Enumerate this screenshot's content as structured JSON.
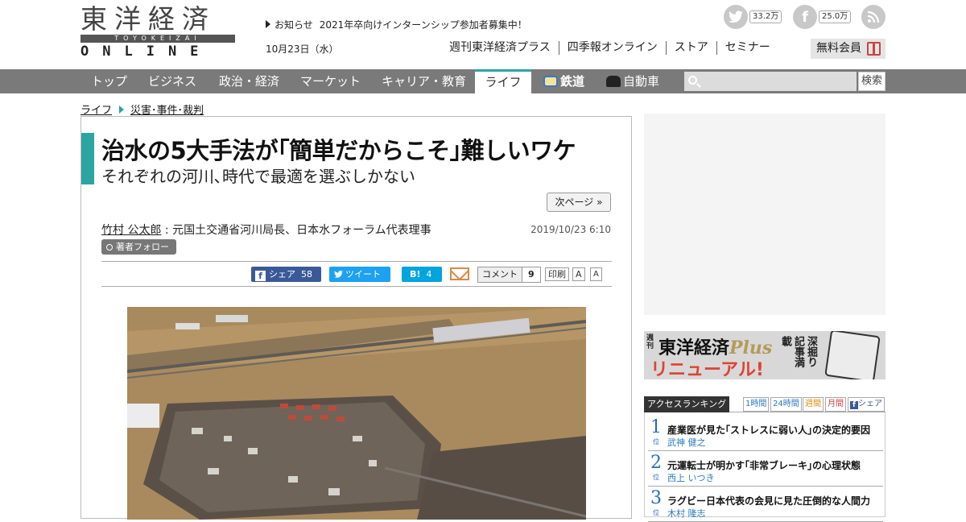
{
  "header": {
    "logo_kanji": "東洋経済",
    "logo_bar": "TOYOKEIZAI",
    "logo_online": "ONLINE",
    "notice_label": "お知らせ",
    "notice_text": "2021年卒向けインターンシップ参加者募集中！",
    "date": "10月23日（水）",
    "twitter_count": "33.2万",
    "facebook_count": "25.0万",
    "subnav": [
      "週刊東洋経済プラス",
      "四季報オンライン",
      "ストア",
      "セミナー"
    ],
    "member_label": "無料会員"
  },
  "nav": {
    "items": [
      "トップ",
      "ビジネス",
      "政治・経済",
      "マーケット",
      "キャリア・教育",
      "ライフ",
      "鉄道",
      "自動車"
    ],
    "active": "ライフ",
    "search_placeholder": "",
    "search_button": "検索"
  },
  "breadcrumb": [
    "ライフ",
    "災害･事件･裁判"
  ],
  "article": {
    "title": "治水の5大手法が｢簡単だからこそ｣難しいワケ",
    "subtitle": "それぞれの河川､時代で最適を選ぶしかない",
    "next_page": "次ページ »",
    "author_name": "竹村 公太郎",
    "author_title": " : 元国土交通省河川局長、日本水フォーラム代表理事",
    "published": "2019/10/23 6:10",
    "follow_label": "著者フォロー",
    "share": {
      "facebook_label": "シェア",
      "facebook_count": "58",
      "twitter_label": "ツイート",
      "hatena_label": "B!",
      "hatena_count": "4",
      "comment_label": "コメント",
      "comment_count": "9",
      "print_label": "印刷",
      "font_a1": "A",
      "font_a2": "A"
    }
  },
  "sidebar": {
    "banner_plus_small": "週刊",
    "banner_title": "東洋経済",
    "banner_plus": "Plus",
    "banner_renewal": "リニューアル!",
    "banner_tagline": "深掘り記事満載",
    "ranking_title": "アクセスランキング",
    "ranking_tabs": [
      "1時間",
      "24時間",
      "週間",
      "月間",
      "シェア"
    ],
    "ranking": [
      {
        "rank": "1",
        "unit": "位",
        "title": "産業医が見た｢ストレスに弱い人｣の決定的要因",
        "author": "武神 健之"
      },
      {
        "rank": "2",
        "unit": "位",
        "title": "元運転士が明かす｢非常ブレーキ｣の心理状態",
        "author": "西上 いつき"
      },
      {
        "rank": "3",
        "unit": "位",
        "title": "ラグビー日本代表の会見に見た圧倒的な人間力",
        "author": "木村 隆志"
      }
    ]
  },
  "colors": {
    "accent": "#2aa5a0",
    "nav_bg": "#7a7a7a",
    "facebook": "#3b5998",
    "twitter": "#1da1f2",
    "hatena": "#00a4de",
    "rank_blue": "#2a6ac0"
  }
}
